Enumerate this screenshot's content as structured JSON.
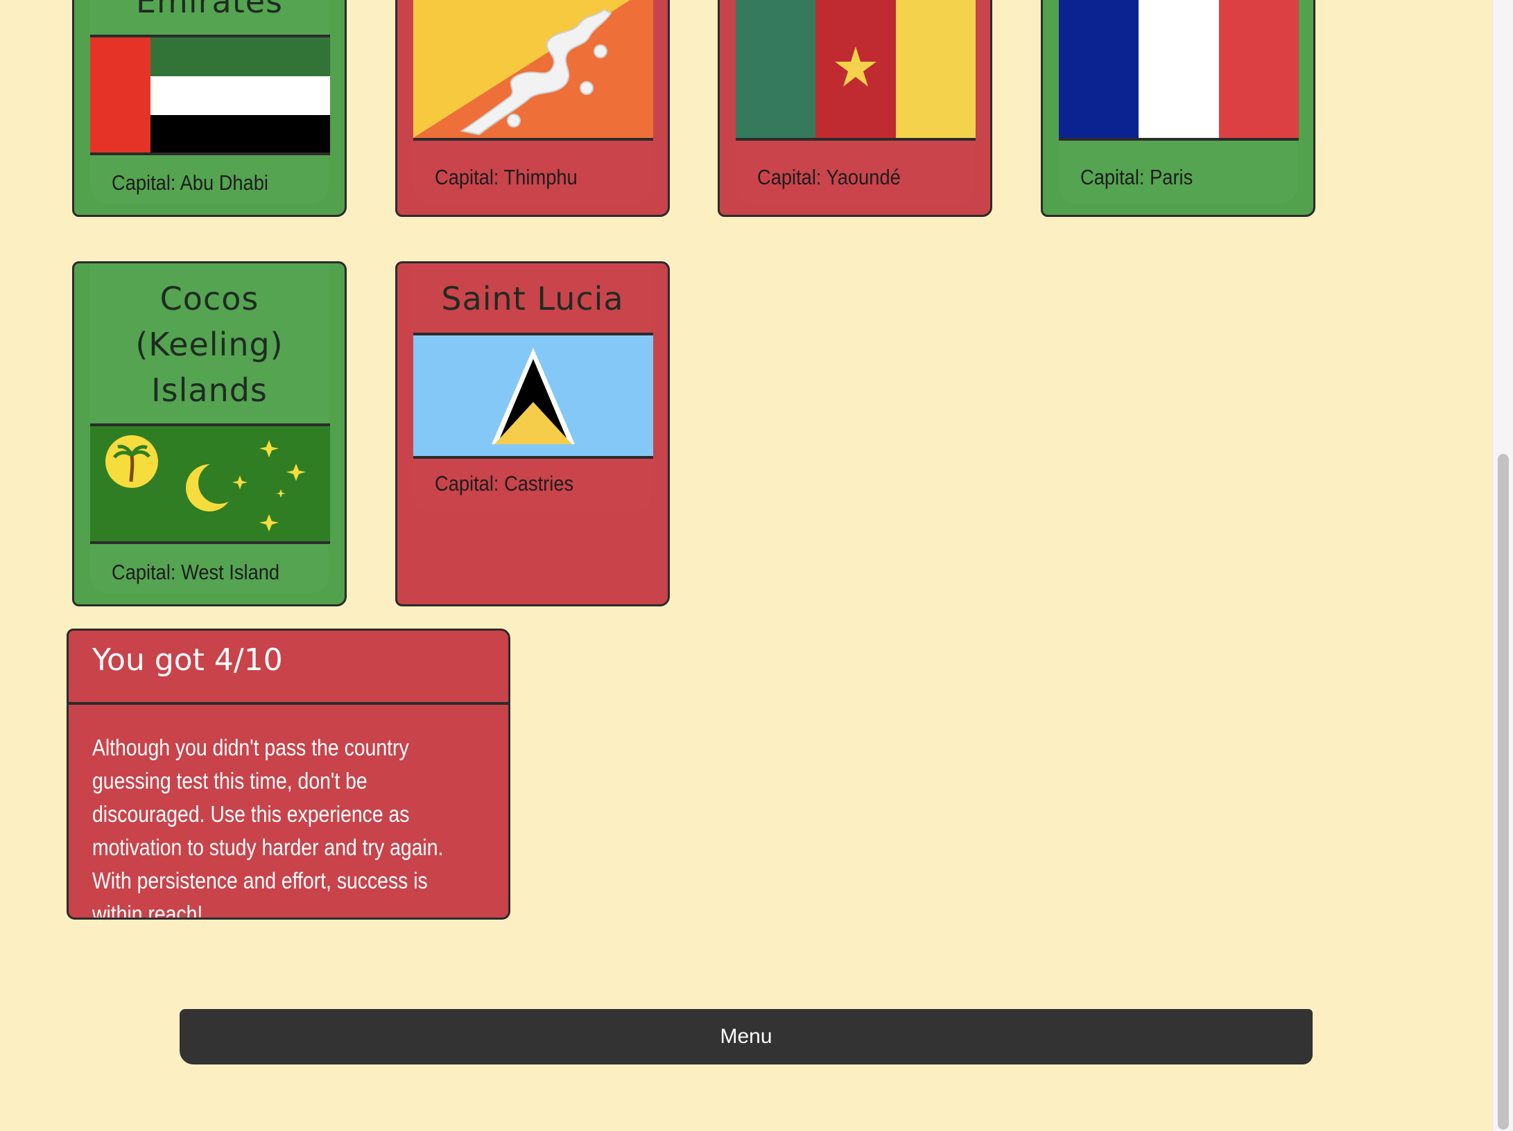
{
  "cards": [
    {
      "title": "Emirates",
      "capital": "Capital: Abu Dhabi",
      "status": "correct",
      "flag_icon": "uae-flag-icon"
    },
    {
      "title": "",
      "capital": "Capital: Thimphu",
      "status": "incorrect",
      "flag_icon": "bhutan-flag-icon"
    },
    {
      "title": "",
      "capital": "Capital: Yaoundé",
      "status": "incorrect",
      "flag_icon": "cameroon-flag-icon"
    },
    {
      "title": "",
      "capital": "Capital: Paris",
      "status": "correct",
      "flag_icon": "france-flag-icon"
    },
    {
      "title_lines": [
        "Cocos",
        "(Keeling)",
        "Islands"
      ],
      "capital": "Capital: West Island",
      "status": "correct",
      "flag_icon": "cocos-islands-flag-icon"
    },
    {
      "title": "Saint Lucia",
      "capital": "Capital: Castries",
      "status": "incorrect",
      "flag_icon": "saint-lucia-flag-icon"
    }
  ],
  "result": {
    "title": "You got 4/10",
    "text": "Although you didn't pass the country guessing test this time, don't be discouraged. Use this experience as motivation to study harder and try again. With persistence and effort, success is within reach!"
  },
  "menu": {
    "label": "Menu"
  },
  "colors": {
    "background": "#fcf0c3",
    "correct": "#52a14d",
    "incorrect": "#c9434a",
    "button": "#333333"
  }
}
